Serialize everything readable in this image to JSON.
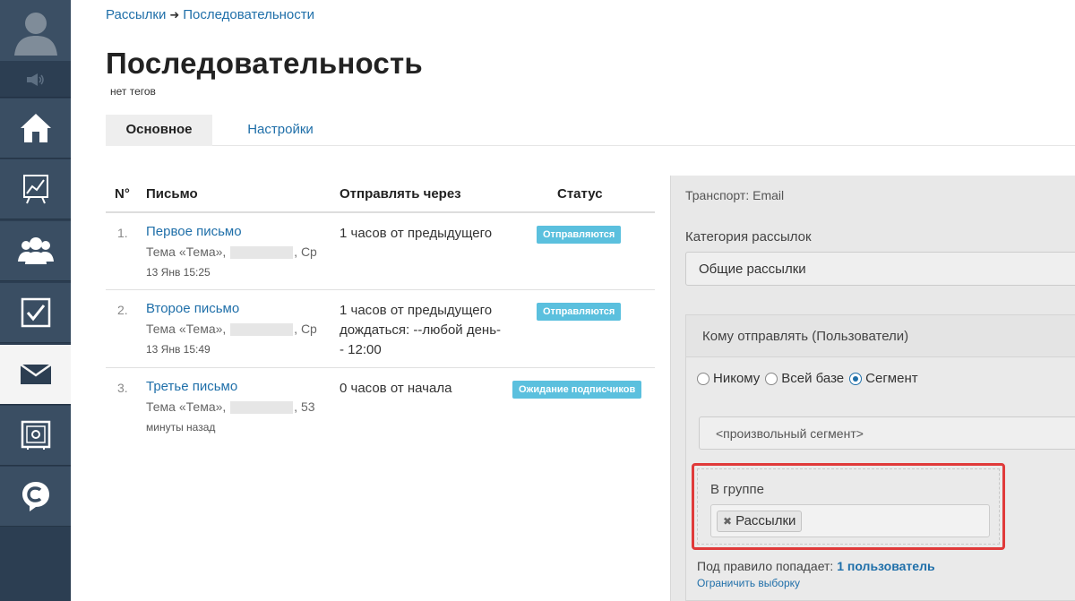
{
  "breadcrumb": {
    "root": "Рассылки",
    "separator": "➜",
    "current": "Последовательности"
  },
  "page": {
    "title": "Последовательность",
    "tags": "нет тегов"
  },
  "tabs": [
    {
      "label": "Основное",
      "active": true
    },
    {
      "label": "Настройки",
      "active": false
    }
  ],
  "table": {
    "headers": {
      "num": "N°",
      "letter": "Письмо",
      "send_after": "Отправлять через",
      "status": "Статус"
    },
    "rows": [
      {
        "num": "1.",
        "name": "Первое письмо",
        "subject_prefix": "Тема «Тема»,",
        "subject_suffix": ", Ср",
        "date": "13 Янв 15:25",
        "delay": "1 часов от предыдущего",
        "status": "Отправляются"
      },
      {
        "num": "2.",
        "name": "Второе письмо",
        "subject_prefix": "Тема «Тема»,",
        "subject_suffix": ", Ср",
        "date": "13 Янв 15:49",
        "delay": "1 часов от предыдущего дождаться: --любой день-- 12:00",
        "status": "Отправляются"
      },
      {
        "num": "3.",
        "name": "Третье письмо",
        "subject_prefix": "Тема «Тема»,",
        "subject_suffix": ", 53",
        "date": "минуты назад",
        "delay": "0 часов от начала",
        "status": "Ожидание подписчиков"
      }
    ]
  },
  "panel": {
    "transport": "Транспорт: Email",
    "category_label": "Категория рассылок",
    "category_value": "Общие рассылки",
    "recipients_header": "Кому отправлять (Пользователи)",
    "radios": [
      {
        "label": "Никому",
        "checked": false
      },
      {
        "label": "Всей базе",
        "checked": false
      },
      {
        "label": "Сегмент",
        "checked": true
      }
    ],
    "segment_value": "<произвольный сегмент>",
    "group_label": "В группе",
    "group_chip": "Рассылки",
    "rule_text": "Под правило попадает:",
    "rule_count": "1 пользователь",
    "limit_link": "Ограничить выборку"
  },
  "colors": {
    "sidebar": "#2c3e52",
    "link": "#1f6fa9",
    "badge": "#5bc0de",
    "highlight": "#e03a3a"
  },
  "icons": [
    "user-avatar-icon",
    "volume-icon",
    "home-icon",
    "chart-icon",
    "users-icon",
    "checkbox-icon",
    "mail-icon",
    "safe-icon",
    "chat-c-icon"
  ]
}
